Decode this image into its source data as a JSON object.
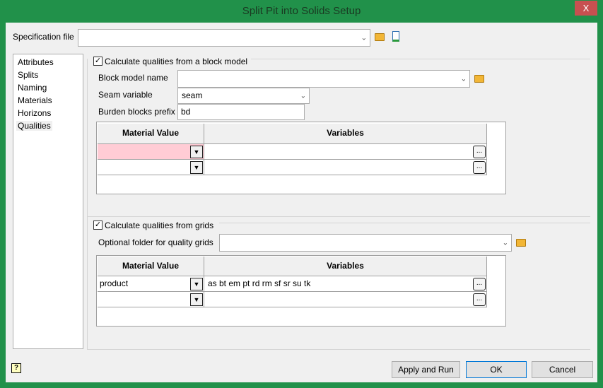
{
  "window": {
    "title": "Split Pit into Solids Setup",
    "close": "X"
  },
  "spec": {
    "label": "Specification file",
    "value": ""
  },
  "sidebar": {
    "items": [
      {
        "label": "Attributes"
      },
      {
        "label": "Splits"
      },
      {
        "label": "Naming"
      },
      {
        "label": "Materials"
      },
      {
        "label": "Horizons"
      },
      {
        "label": "Qualities",
        "selected": true
      }
    ]
  },
  "block": {
    "checkbox": "Calculate qualities from a block model",
    "checked": true,
    "model_label": "Block model name",
    "model_value": "",
    "seam_label": "Seam variable",
    "seam_value": "seam",
    "prefix_label": "Burden blocks prefix",
    "prefix_value": "bd",
    "table": {
      "headers": [
        "Material Value",
        "Variables"
      ],
      "rows": [
        [
          "",
          ""
        ],
        [
          "",
          ""
        ]
      ]
    }
  },
  "grids": {
    "checkbox": "Calculate qualities from grids",
    "checked": true,
    "folder_label": "Optional folder for quality grids",
    "folder_value": "",
    "table": {
      "headers": [
        "Material Value",
        "Variables"
      ],
      "rows": [
        [
          "product",
          "as bt em pt rd rm sf sr su tk"
        ],
        [
          "",
          ""
        ]
      ]
    }
  },
  "buttons": {
    "apply": "Apply and Run",
    "ok": "OK",
    "cancel": "Cancel",
    "ellipsis": "...",
    "check": "✓",
    "dropdown": "▼",
    "chevron": "⌄"
  },
  "colors": {
    "titlebar": "#21914a",
    "required_cell": "#ffccd5",
    "close": "#c75050"
  }
}
